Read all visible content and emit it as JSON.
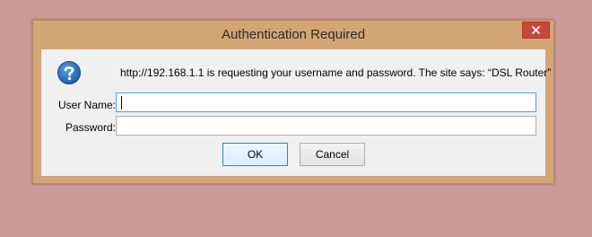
{
  "dialog": {
    "title": "Authentication Required",
    "message": "http://192.168.1.1 is requesting your username and password. The site says: “DSL Router”",
    "username_label": "User Name:",
    "username_value": "",
    "password_label": "Password:",
    "password_value": "",
    "ok_label": "OK",
    "cancel_label": "Cancel",
    "icon": "question-icon",
    "close_icon": "close-icon"
  },
  "colors": {
    "desktop": "#cc9999",
    "frame": "#d4a574",
    "close_button": "#c7473c",
    "client_bg": "#f0f0f0",
    "focus_border": "#569de5",
    "icon_blue": "#1f5fa8"
  }
}
